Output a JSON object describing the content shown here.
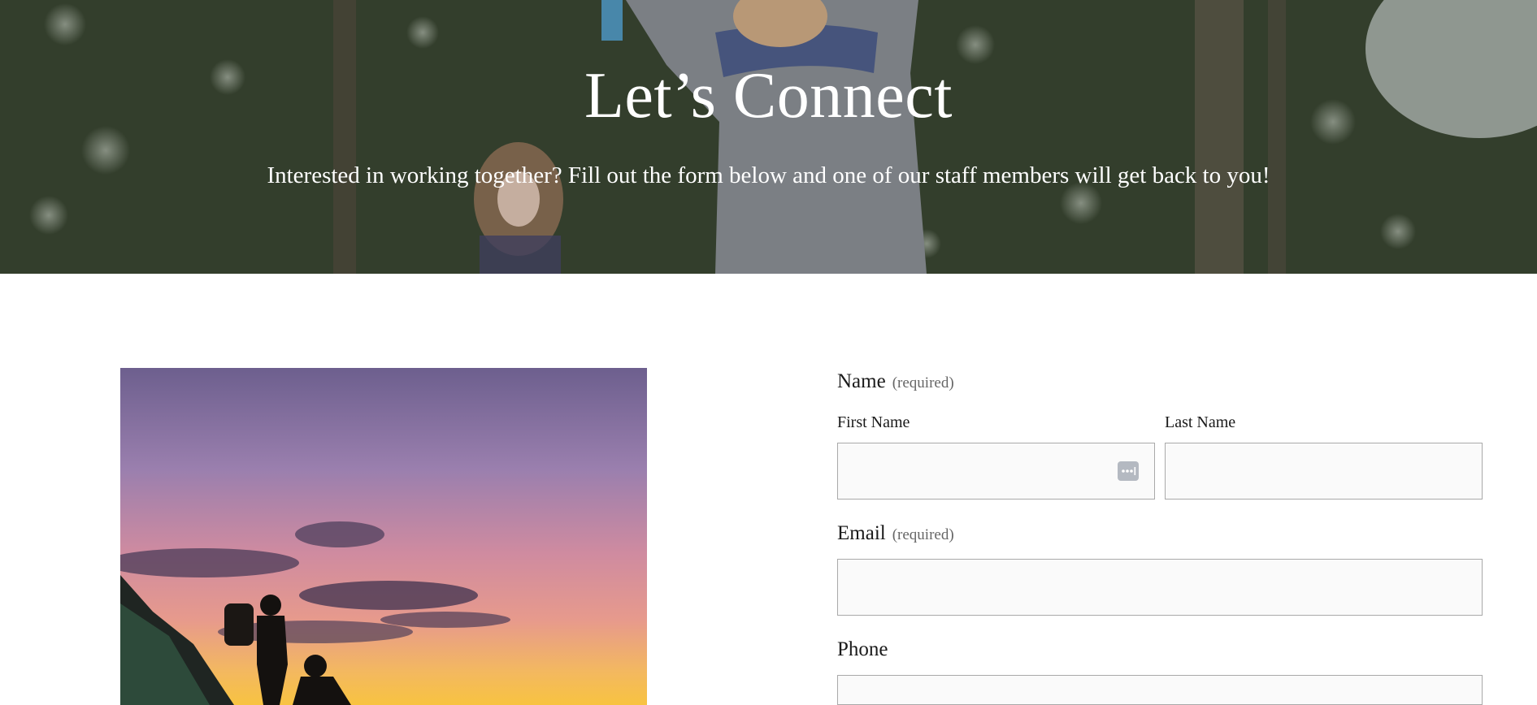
{
  "hero": {
    "title": "Let’s Connect",
    "subtitle": "Interested in working together? Fill out the form below and one of our staff members will get back to you!"
  },
  "form": {
    "name": {
      "label": "Name",
      "required": "(required)",
      "first_label": "First Name",
      "first_value": "",
      "last_label": "Last Name",
      "last_value": ""
    },
    "email": {
      "label": "Email",
      "required": "(required)",
      "value": ""
    },
    "phone": {
      "label": "Phone",
      "value": ""
    }
  },
  "colors": {
    "field_background": "#fafafa",
    "field_border": "#a9a9a9",
    "required_text": "#666666"
  }
}
